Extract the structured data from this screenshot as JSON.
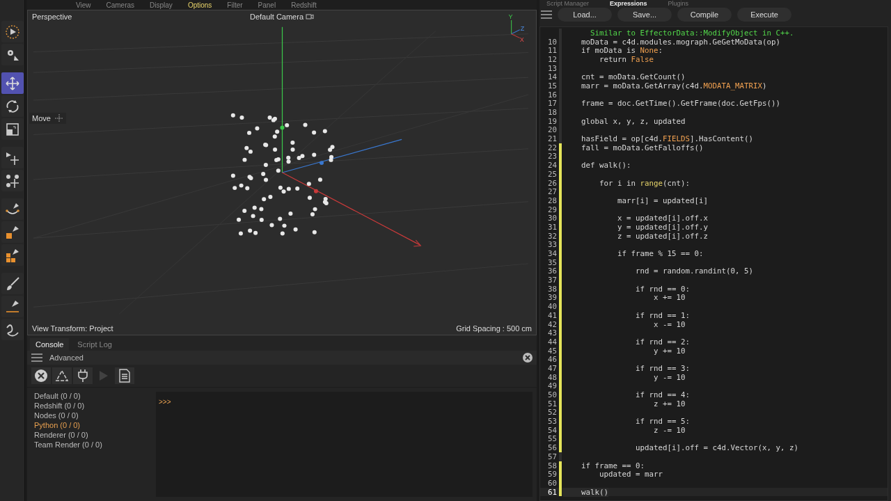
{
  "menu": [
    {
      "label": "View",
      "selected": false
    },
    {
      "label": "Cameras",
      "selected": false
    },
    {
      "label": "Display",
      "selected": false
    },
    {
      "label": "Options",
      "selected": true
    },
    {
      "label": "Filter",
      "selected": false
    },
    {
      "label": "Panel",
      "selected": false
    },
    {
      "label": "Redshift",
      "selected": false
    }
  ],
  "tools": [
    {
      "kind": "select",
      "selected": false
    },
    {
      "kind": "gear",
      "selected": false
    },
    {
      "kind": "move",
      "selected": true
    },
    {
      "kind": "rotate",
      "selected": false
    },
    {
      "kind": "scale",
      "selected": false
    },
    {
      "kind": "move-points",
      "selected": false
    },
    {
      "kind": "move-clusters",
      "selected": false
    },
    {
      "kind": "pen-arc",
      "selected": false
    },
    {
      "kind": "pen-square",
      "selected": false
    },
    {
      "kind": "pen-cubes",
      "selected": false
    },
    {
      "kind": "brush",
      "selected": false
    },
    {
      "kind": "pen-line",
      "selected": false
    },
    {
      "kind": "squiggle",
      "selected": false
    }
  ],
  "viewport": {
    "name": "Perspective",
    "camera": "Default Camera",
    "tool_label": "Move",
    "view_transform": "View Transform: Project",
    "grid_spacing": "Grid Spacing : 500 cm",
    "axes": [
      "Y",
      "Z",
      "X"
    ]
  },
  "console": {
    "tabs": [
      {
        "label": "Console",
        "selected": true
      },
      {
        "label": "Script Log",
        "selected": false
      }
    ],
    "title": "Advanced",
    "actions": [
      {
        "kind": "clear",
        "disabled": false
      },
      {
        "kind": "recycle",
        "disabled": false
      },
      {
        "kind": "plug",
        "disabled": false
      },
      {
        "kind": "play",
        "disabled": true
      },
      {
        "kind": "document",
        "disabled": false
      }
    ],
    "categories": [
      {
        "label": "Default (0 / 0)",
        "selected": false
      },
      {
        "label": "Redshift (0 / 0)",
        "selected": false
      },
      {
        "label": "Nodes (0 / 0)",
        "selected": false
      },
      {
        "label": "Python (0 / 0)",
        "selected": true
      },
      {
        "label": "Renderer (0 / 0)",
        "selected": false
      },
      {
        "label": "Team Render  (0 / 0)",
        "selected": false
      }
    ],
    "prompt": ">>>"
  },
  "script_panel": {
    "tabs": [
      {
        "label": "Script Manager",
        "selected": false
      },
      {
        "label": "Expressions",
        "selected": true
      },
      {
        "label": "Plugins",
        "selected": false
      }
    ],
    "buttons": [
      "Load...",
      "Save...",
      "Compile",
      "Execute"
    ],
    "lines": [
      {
        "changed": false,
        "current": false,
        "tokens": [
          {
            "kind": "doc",
            "text": "      Similar to EffectorData::ModifyObject in C++."
          }
        ]
      },
      {
        "num": "10",
        "changed": false,
        "current": false,
        "tokens": [
          {
            "kind": "plain",
            "text": "    moData = c4d.modules.mograph.GeGetMoData(op)"
          }
        ]
      },
      {
        "num": "11",
        "changed": false,
        "current": false,
        "tokens": [
          {
            "kind": "plain",
            "text": "    if moData is "
          },
          {
            "kind": "const",
            "text": "None"
          },
          {
            "kind": "plain",
            "text": ":"
          }
        ]
      },
      {
        "num": "12",
        "changed": false,
        "current": false,
        "tokens": [
          {
            "kind": "plain",
            "text": "        return "
          },
          {
            "kind": "const",
            "text": "False"
          }
        ]
      },
      {
        "num": "13",
        "changed": false,
        "current": false
      },
      {
        "num": "14",
        "changed": false,
        "current": false,
        "tokens": [
          {
            "kind": "plain",
            "text": "    cnt = moData.GetCount()"
          }
        ]
      },
      {
        "num": "15",
        "changed": false,
        "current": false,
        "tokens": [
          {
            "kind": "plain",
            "text": "    marr = moData.GetArray(c4d."
          },
          {
            "kind": "const",
            "text": "MODATA_MATRIX"
          },
          {
            "kind": "plain",
            "text": ")"
          }
        ]
      },
      {
        "num": "16",
        "changed": false,
        "current": false
      },
      {
        "num": "17",
        "changed": false,
        "current": false,
        "tokens": [
          {
            "kind": "plain",
            "text": "    frame = doc.GetTime().GetFrame(doc.GetFps())"
          }
        ]
      },
      {
        "num": "18",
        "changed": false,
        "current": false
      },
      {
        "num": "19",
        "changed": false,
        "current": false,
        "tokens": [
          {
            "kind": "plain",
            "text": "    global x, y, z, updated"
          }
        ]
      },
      {
        "num": "20",
        "changed": false,
        "current": false
      },
      {
        "num": "21",
        "changed": false,
        "current": false,
        "tokens": [
          {
            "kind": "plain",
            "text": "    hasField = op[c4d."
          },
          {
            "kind": "const",
            "text": "FIELDS"
          },
          {
            "kind": "plain",
            "text": "].HasContent()"
          }
        ]
      },
      {
        "num": "22",
        "changed": true,
        "current": false,
        "tokens": [
          {
            "kind": "plain",
            "text": "    fall = moData.GetFalloffs()"
          }
        ]
      },
      {
        "num": "23",
        "changed": true,
        "current": false
      },
      {
        "num": "24",
        "changed": true,
        "current": false,
        "tokens": [
          {
            "kind": "plain",
            "text": "    def walk():"
          }
        ]
      },
      {
        "num": "25",
        "changed": true,
        "current": false
      },
      {
        "num": "26",
        "changed": true,
        "current": false,
        "tokens": [
          {
            "kind": "plain",
            "text": "        for i in "
          },
          {
            "kind": "builtin",
            "text": "range"
          },
          {
            "kind": "plain",
            "text": "(cnt):"
          }
        ]
      },
      {
        "num": "27",
        "changed": true,
        "current": false
      },
      {
        "num": "28",
        "changed": true,
        "current": false,
        "tokens": [
          {
            "kind": "plain",
            "text": "            marr[i] = updated[i]"
          }
        ]
      },
      {
        "num": "29",
        "changed": true,
        "current": false
      },
      {
        "num": "30",
        "changed": true,
        "current": false,
        "tokens": [
          {
            "kind": "plain",
            "text": "            x = updated[i].off.x"
          }
        ]
      },
      {
        "num": "31",
        "changed": true,
        "current": false,
        "tokens": [
          {
            "kind": "plain",
            "text": "            y = updated[i].off.y"
          }
        ]
      },
      {
        "num": "32",
        "changed": true,
        "current": false,
        "tokens": [
          {
            "kind": "plain",
            "text": "            z = updated[i].off.z"
          }
        ]
      },
      {
        "num": "33",
        "changed": true,
        "current": false
      },
      {
        "num": "34",
        "changed": true,
        "current": false,
        "tokens": [
          {
            "kind": "plain",
            "text": "            if frame % 15 == 0:"
          }
        ]
      },
      {
        "num": "35",
        "changed": true,
        "current": false
      },
      {
        "num": "36",
        "changed": true,
        "current": false,
        "tokens": [
          {
            "kind": "plain",
            "text": "                rnd = random.randint(0, 5)"
          }
        ]
      },
      {
        "num": "37",
        "changed": true,
        "current": false
      },
      {
        "num": "38",
        "changed": true,
        "current": false,
        "tokens": [
          {
            "kind": "plain",
            "text": "                if rnd == 0:"
          }
        ]
      },
      {
        "num": "39",
        "changed": true,
        "current": false,
        "tokens": [
          {
            "kind": "plain",
            "text": "                    x += 10"
          }
        ]
      },
      {
        "num": "40",
        "changed": true,
        "current": false
      },
      {
        "num": "41",
        "changed": true,
        "current": false,
        "tokens": [
          {
            "kind": "plain",
            "text": "                if rnd == 1:"
          }
        ]
      },
      {
        "num": "42",
        "changed": true,
        "current": false,
        "tokens": [
          {
            "kind": "plain",
            "text": "                    x -= 10"
          }
        ]
      },
      {
        "num": "43",
        "changed": true,
        "current": false
      },
      {
        "num": "44",
        "changed": true,
        "current": false,
        "tokens": [
          {
            "kind": "plain",
            "text": "                if rnd == 2:"
          }
        ]
      },
      {
        "num": "45",
        "changed": true,
        "current": false,
        "tokens": [
          {
            "kind": "plain",
            "text": "                    y += 10"
          }
        ]
      },
      {
        "num": "46",
        "changed": true,
        "current": false
      },
      {
        "num": "47",
        "changed": true,
        "current": false,
        "tokens": [
          {
            "kind": "plain",
            "text": "                if rnd == 3:"
          }
        ]
      },
      {
        "num": "48",
        "changed": true,
        "current": false,
        "tokens": [
          {
            "kind": "plain",
            "text": "                    y -= 10"
          }
        ]
      },
      {
        "num": "49",
        "changed": true,
        "current": false
      },
      {
        "num": "50",
        "changed": true,
        "current": false,
        "tokens": [
          {
            "kind": "plain",
            "text": "                if rnd == 4:"
          }
        ]
      },
      {
        "num": "51",
        "changed": true,
        "current": false,
        "tokens": [
          {
            "kind": "plain",
            "text": "                    z += 10"
          }
        ]
      },
      {
        "num": "52",
        "changed": true,
        "current": false
      },
      {
        "num": "53",
        "changed": true,
        "current": false,
        "tokens": [
          {
            "kind": "plain",
            "text": "                if rnd == 5:"
          }
        ]
      },
      {
        "num": "54",
        "changed": true,
        "current": false,
        "tokens": [
          {
            "kind": "plain",
            "text": "                    z -= 10"
          }
        ]
      },
      {
        "num": "55",
        "changed": true,
        "current": false
      },
      {
        "num": "56",
        "changed": true,
        "current": false,
        "tokens": [
          {
            "kind": "plain",
            "text": "                updated[i].off = c4d.Vector(x, y, z)"
          }
        ]
      },
      {
        "num": "57",
        "changed": false,
        "current": false
      },
      {
        "num": "58",
        "changed": true,
        "current": false,
        "tokens": [
          {
            "kind": "plain",
            "text": "    if frame == 0:"
          }
        ]
      },
      {
        "num": "59",
        "changed": true,
        "current": false,
        "tokens": [
          {
            "kind": "plain",
            "text": "        updated = marr"
          }
        ]
      },
      {
        "num": "60",
        "changed": true,
        "current": false
      },
      {
        "num": "61",
        "changed": true,
        "current": true,
        "tokens": [
          {
            "kind": "plain",
            "text": "    walk()"
          }
        ]
      }
    ]
  }
}
